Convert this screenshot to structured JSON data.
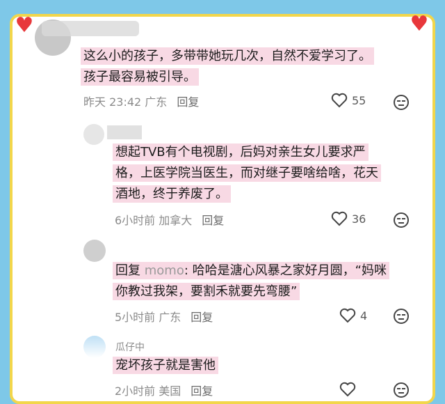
{
  "comments": [
    {
      "text_lines": [
        "这么小的孩子，多带带她玩几次，自然不爱学习了。",
        "孩子最容易被引导。"
      ],
      "time": "昨天 23:42",
      "location": "广东",
      "reply_label": "回复",
      "likes": "55"
    },
    {
      "text_lines": [
        "想起TVB有个电视剧，后妈对亲生女儿要求严",
        "格，上医学院当医生，而对继子要啥给啥，花天",
        "酒地，终于养废了。"
      ],
      "time": "6小时前",
      "location": "加拿大",
      "reply_label": "回复",
      "likes": "36"
    },
    {
      "reply_prefix": "回复",
      "mention": "momo",
      "text_lines": [
        ": 哈哈是溏心风暴之家好月圆，“妈咪",
        "你教过我架，要割禾就要先弯腰”"
      ],
      "time": "5小时前",
      "location": "广东",
      "reply_label": "回复",
      "likes": "4"
    },
    {
      "username": "瓜仔中",
      "text_lines": [
        "宠坏孩子就是害他"
      ],
      "time": "2小时前",
      "location": "美国",
      "reply_label": "回复",
      "likes": ""
    }
  ],
  "colors": {
    "highlight": "#f8d9e4",
    "frame": "#f2d64b",
    "heart": "#e8383b"
  }
}
